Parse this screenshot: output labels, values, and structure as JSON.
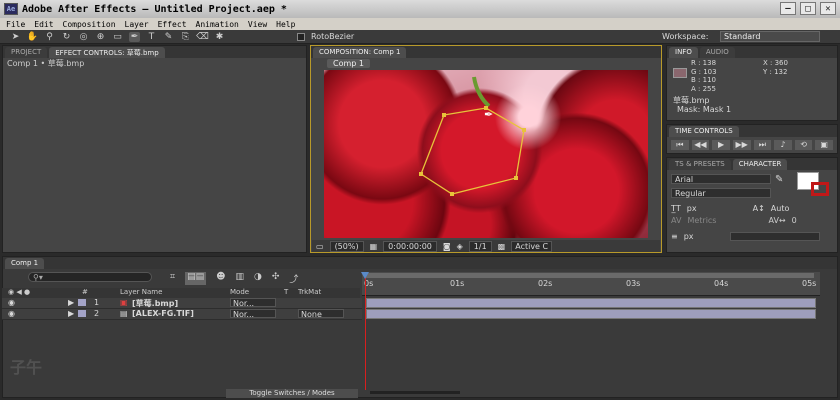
{
  "app": {
    "title": "Adobe After Effects – Untitled Project.aep *",
    "logo_text": "Ae"
  },
  "menu": [
    "File",
    "Edit",
    "Composition",
    "Layer",
    "Effect",
    "Animation",
    "View",
    "Help"
  ],
  "toolbar": {
    "rotobezier_label": "RotoBezier",
    "workspace_label": "Workspace:",
    "workspace_value": "Standard"
  },
  "project_panel": {
    "tabs": [
      "PROJECT",
      "EFFECT CONTROLS: 草莓.bmp"
    ],
    "subheader": "Comp 1 • 草莓.bmp"
  },
  "composition_panel": {
    "tab": "COMPOSITION: Comp 1",
    "comp_button": "Comp 1",
    "zoom": "(50%)",
    "timecode": "0:00:00:00",
    "resolution": "1/1",
    "view": "Active C"
  },
  "info_panel": {
    "tabs": [
      "INFO",
      "AUDIO"
    ],
    "r": "R : 138",
    "g": "G : 103",
    "b": "B : 110",
    "a": "A : 255",
    "x": "X : 360",
    "y": "Y : 132",
    "swatch_color": "#8a676e",
    "layer_name": "草莓.bmp",
    "mask": "Mask: Mask 1"
  },
  "time_controls": {
    "tab": "TIME CONTROLS"
  },
  "character_panel": {
    "tabs": [
      "TS & PRESETS",
      "CHARACTER"
    ],
    "font": "Arial",
    "style": "Regular",
    "size_unit": "px",
    "leading": "Auto",
    "metrics": "Metrics",
    "tracking": "0",
    "stroke_unit": "px"
  },
  "timeline": {
    "tab": "Comp 1",
    "columns": {
      "num": "#",
      "layer_name": "Layer Name",
      "mode": "Mode",
      "t": "T",
      "trkmat": "TrkMat"
    },
    "layers": [
      {
        "num": "1",
        "name": "[草莓.bmp]",
        "mode": "Nor...",
        "trkmat": ""
      },
      {
        "num": "2",
        "name": "[ALEX-FG.TIF]",
        "mode": "Nor...",
        "trkmat": "None"
      }
    ],
    "ruler": [
      "0s",
      "01s",
      "02s",
      "03s",
      "04s",
      "05s"
    ],
    "toggle_label": "Toggle Switches / Modes"
  },
  "colors": {
    "accent": "#e8c33a",
    "playhead": "#d81f1f",
    "layer_bar": "#9e9ebc"
  }
}
